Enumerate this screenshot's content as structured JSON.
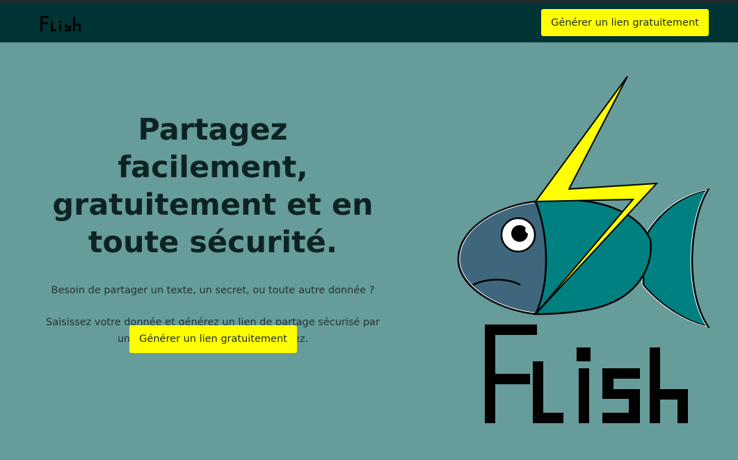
{
  "brand": {
    "name": "Flish",
    "accent_color": "#ffff00",
    "nav_color": "#003333",
    "background_color": "#669c99"
  },
  "nav": {
    "logo_icon": "flish-logo-icon",
    "cta_label": "Générer un lien gratuitement"
  },
  "hero": {
    "title": "Partagez facilement, gratuitement et en toute sécurité.",
    "subtitle": "Besoin de partager un texte, un secret, ou toute autre donnée ?",
    "description": "Saisissez votre donnée et générez un lien de partage sécurisé par un mot de passe que vous choisissez.",
    "cta_label": "Générer un lien gratuitement",
    "illustration_icon": "sad-fish-lightning-icon"
  }
}
